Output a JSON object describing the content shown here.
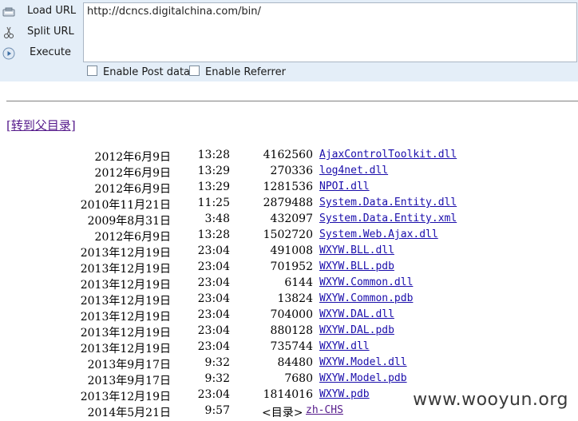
{
  "toolbar": {
    "load_url": "Load URL",
    "split_url": "Split URL",
    "execute": "Execute",
    "url_value": "http://dcncs.digitalchina.com/bin/",
    "enable_post": "Enable Post data",
    "enable_referrer": "Enable Referrer"
  },
  "page": {
    "parent_link": "[转到父目录]"
  },
  "listing": [
    {
      "date": "2012年6月9日",
      "time": "13:28",
      "size": "4162560",
      "name": "AjaxControlToolkit.dll"
    },
    {
      "date": "2012年6月9日",
      "time": "13:29",
      "size": "270336",
      "name": "log4net.dll"
    },
    {
      "date": "2012年6月9日",
      "time": "13:29",
      "size": "1281536",
      "name": "NPOI.dll"
    },
    {
      "date": "2010年11月21日",
      "time": "11:25",
      "size": "2879488",
      "name": "System.Data.Entity.dll"
    },
    {
      "date": "2009年8月31日",
      "time": "3:48",
      "size": "432097",
      "name": "System.Data.Entity.xml"
    },
    {
      "date": "2012年6月9日",
      "time": "13:28",
      "size": "1502720",
      "name": "System.Web.Ajax.dll"
    },
    {
      "date": "2013年12月19日",
      "time": "23:04",
      "size": "491008",
      "name": "WXYW.BLL.dll"
    },
    {
      "date": "2013年12月19日",
      "time": "23:04",
      "size": "701952",
      "name": "WXYW.BLL.pdb"
    },
    {
      "date": "2013年12月19日",
      "time": "23:04",
      "size": "6144",
      "name": "WXYW.Common.dll"
    },
    {
      "date": "2013年12月19日",
      "time": "23:04",
      "size": "13824",
      "name": "WXYW.Common.pdb"
    },
    {
      "date": "2013年12月19日",
      "time": "23:04",
      "size": "704000",
      "name": "WXYW.DAL.dll"
    },
    {
      "date": "2013年12月19日",
      "time": "23:04",
      "size": "880128",
      "name": "WXYW.DAL.pdb"
    },
    {
      "date": "2013年12月19日",
      "time": "23:04",
      "size": "735744",
      "name": "WXYW.dll"
    },
    {
      "date": "2013年9月17日",
      "time": "9:32",
      "size": "84480",
      "name": "WXYW.Model.dll"
    },
    {
      "date": "2013年9月17日",
      "time": "9:32",
      "size": "7680",
      "name": "WXYW.Model.pdb"
    },
    {
      "date": "2013年12月19日",
      "time": "23:04",
      "size": "1814016",
      "name": "WXYW.pdb"
    },
    {
      "date": "2014年5月21日",
      "time": "9:57",
      "tag": "<目录>",
      "name": "zh-CHS",
      "dir": true
    }
  ],
  "watermark": "www.wooyun.org"
}
